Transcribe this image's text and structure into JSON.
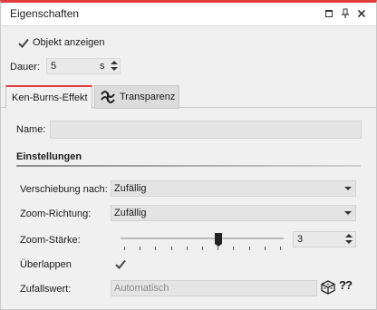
{
  "window": {
    "title": "Eigenschaften",
    "accent_color": "#e03b3b"
  },
  "titlebar_icons": [
    "maximize-icon",
    "pin-icon",
    "close-icon"
  ],
  "show_object": {
    "label": "Objekt anzeigen",
    "checked": true
  },
  "duration": {
    "label": "Dauer:",
    "value": "5",
    "unit": "s"
  },
  "tabs": [
    {
      "label": "Ken-Burns-Effekt",
      "active": true
    },
    {
      "label": "Transparenz",
      "active": false,
      "icon": "transparency-icon"
    }
  ],
  "name": {
    "label": "Name:",
    "value": ""
  },
  "settings": {
    "title": "Einstellungen",
    "shift": {
      "label": "Verschiebung nach:",
      "value": "Zufällig"
    },
    "zoom_direction": {
      "label": "Zoom-Richtung:",
      "value": "Zufällig"
    },
    "zoom_strength": {
      "label": "Zoom-Stärke:",
      "value": "3",
      "slider_fraction": 0.6
    },
    "overlap": {
      "label": "Überlappen",
      "checked": true
    },
    "random_value": {
      "label": "Zufallswert:",
      "placeholder": "Automatisch"
    },
    "help_label": "??"
  }
}
